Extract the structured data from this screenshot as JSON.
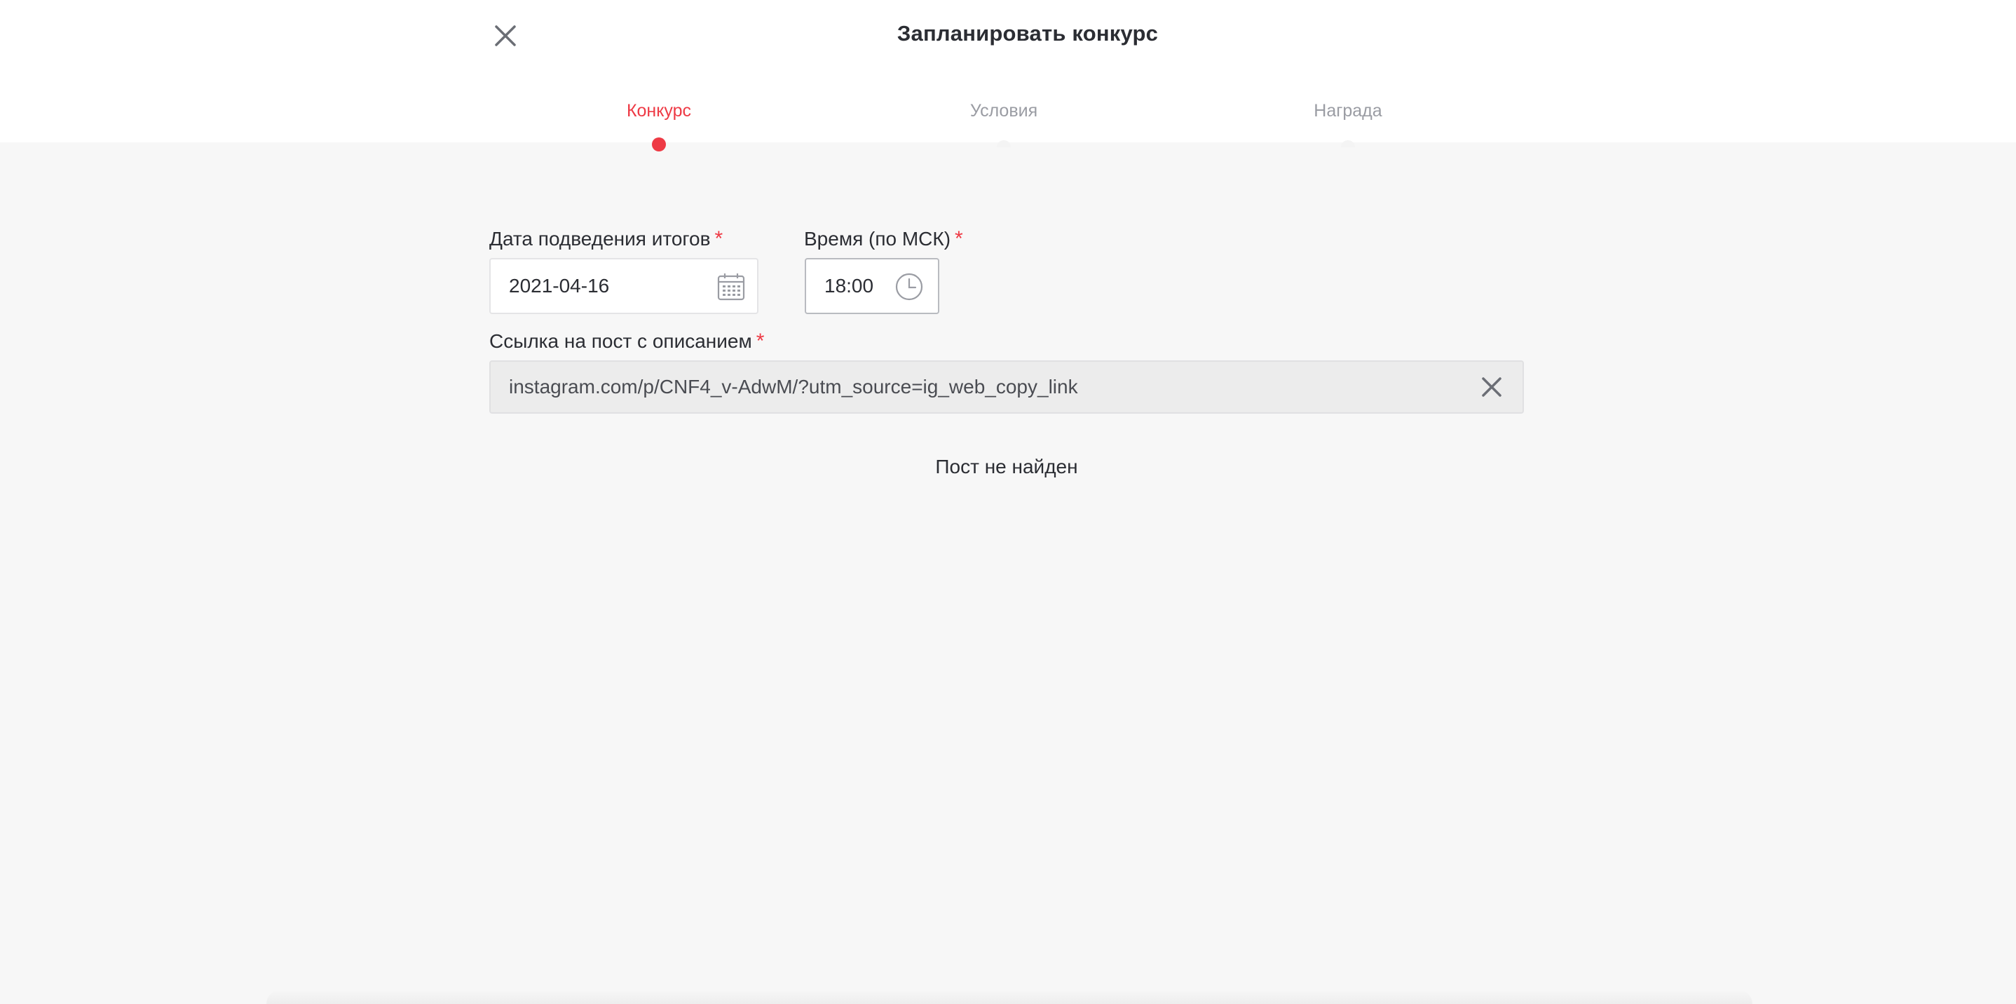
{
  "header": {
    "title": "Запланировать конкурс",
    "close_icon": "close-icon"
  },
  "steps": [
    {
      "label": "Конкурс",
      "active": true
    },
    {
      "label": "Условия",
      "active": false
    },
    {
      "label": "Награда",
      "active": false
    }
  ],
  "form": {
    "date_label": "Дата подведения итогов",
    "date_value": "2021-04-16",
    "date_icon": "calendar-icon",
    "time_label": "Время (по МСК)",
    "time_value": "18:00",
    "time_icon": "clock-icon",
    "url_label": "Ссылка на пост с описанием",
    "url_value": "instagram.com/p/CNF4_v-AdwM/?utm_source=ig_web_copy_link",
    "url_clear_icon": "clear-icon",
    "required_mark": "*"
  },
  "status_message": "Пост не найден",
  "colors": {
    "accent": "#ee3a45",
    "background": "#f7f7f7",
    "text": "#2b2d33",
    "muted": "#9a9ca3"
  }
}
